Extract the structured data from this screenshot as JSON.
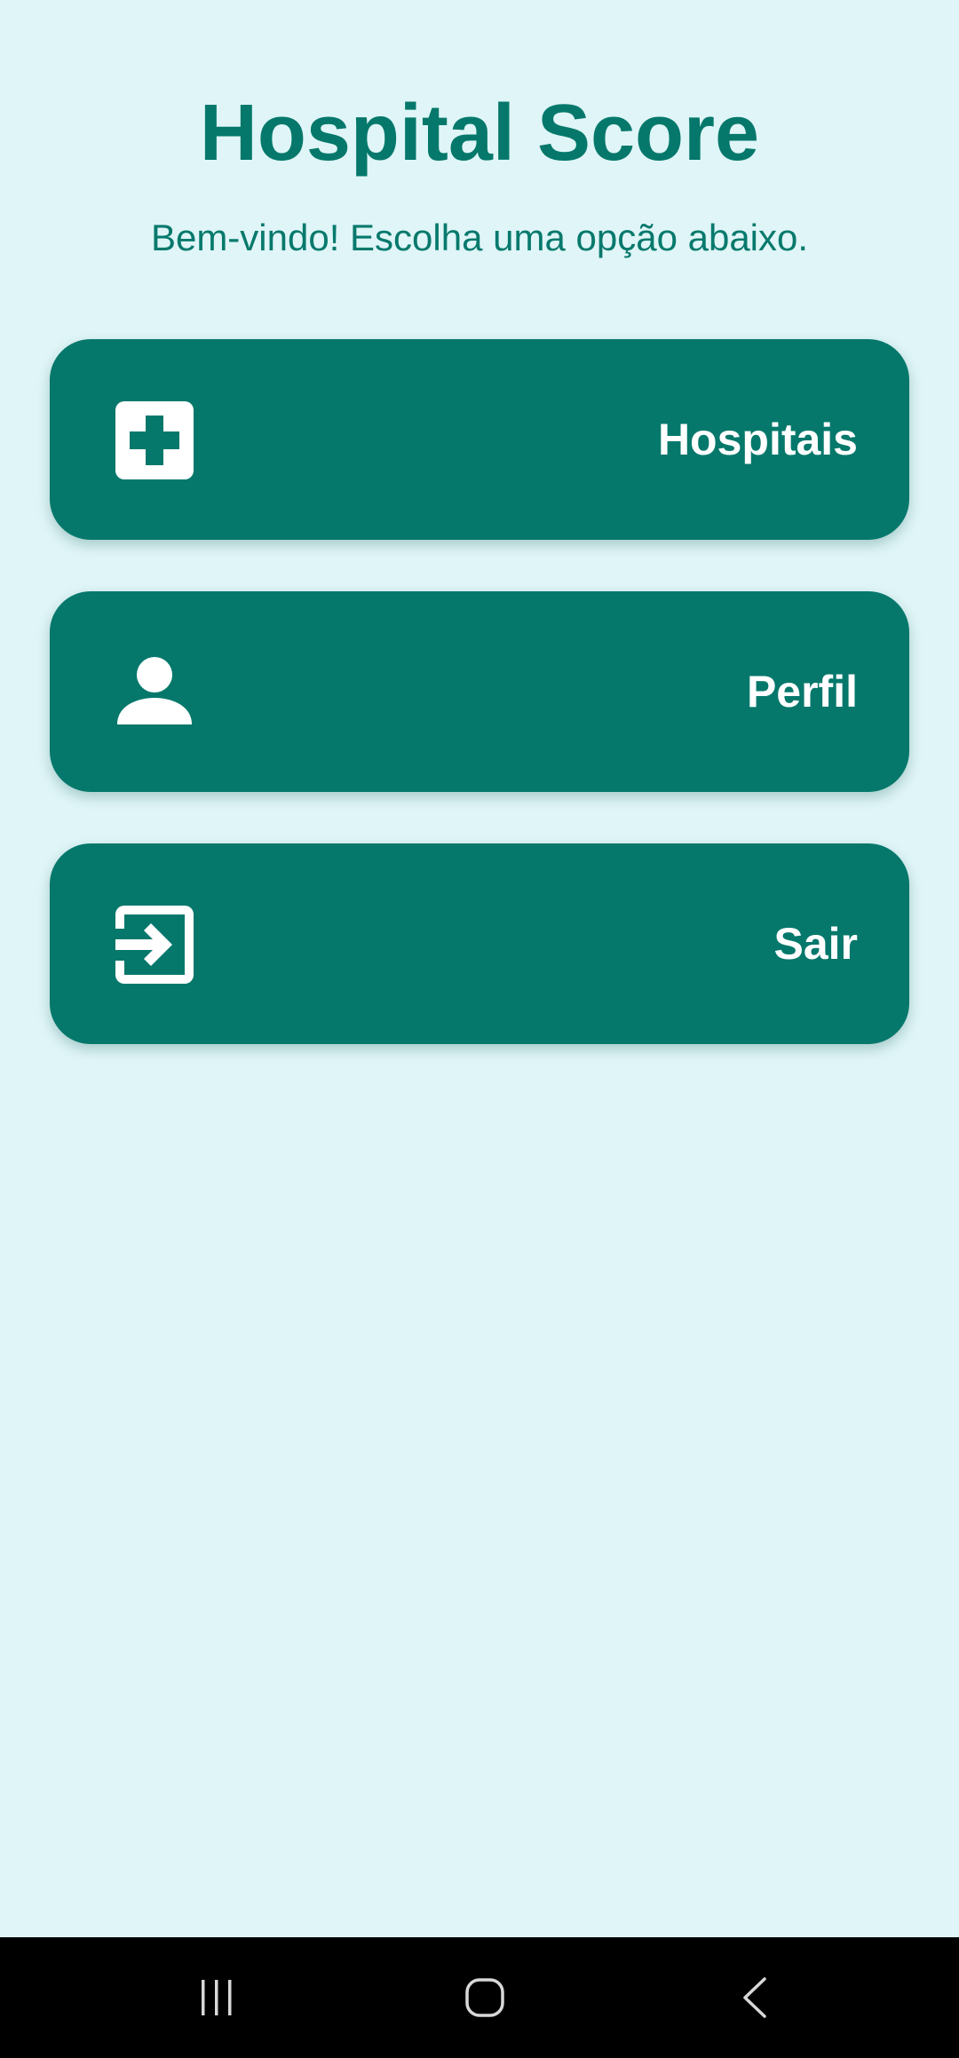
{
  "app": {
    "title": "Hospital Score",
    "subtitle": "Bem-vindo! Escolha uma opção abaixo."
  },
  "menu": {
    "items": [
      {
        "label": "Hospitais",
        "icon": "hospital-cross-icon"
      },
      {
        "label": "Perfil",
        "icon": "person-icon"
      },
      {
        "label": "Sair",
        "icon": "logout-icon"
      }
    ]
  },
  "system_nav": {
    "buttons": [
      {
        "icon": "recents-icon"
      },
      {
        "icon": "home-icon"
      },
      {
        "icon": "back-icon"
      }
    ]
  },
  "colors": {
    "background": "#dff5f7",
    "primary": "#05786b",
    "on_primary": "#ffffff",
    "nav_bar": "#000000"
  }
}
